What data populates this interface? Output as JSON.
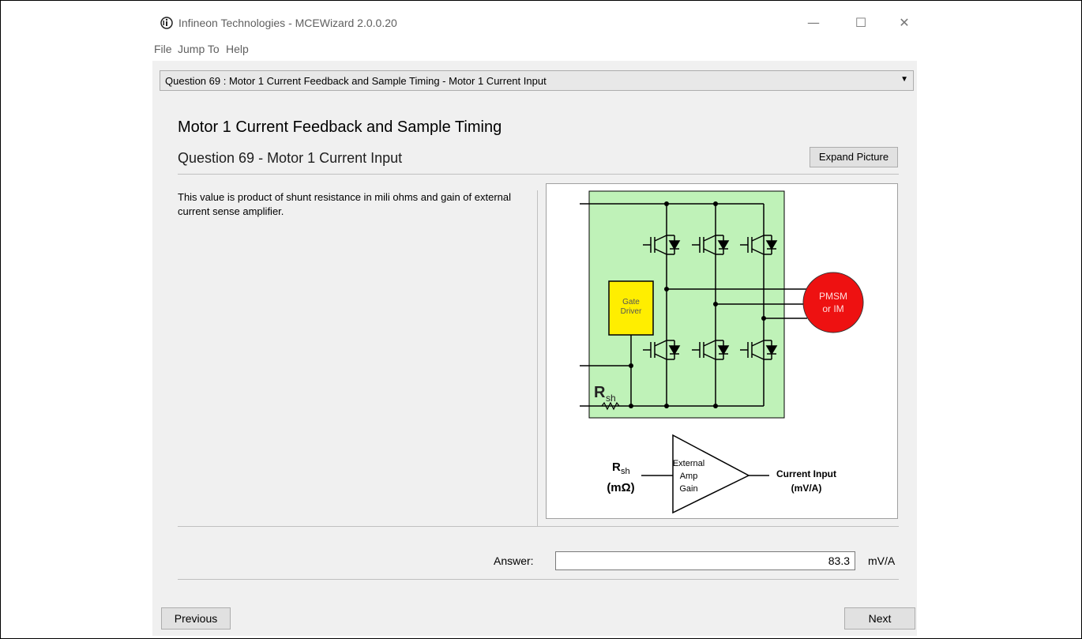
{
  "window": {
    "title": "Infineon Technologies - MCEWizard 2.0.0.20",
    "minimize_glyph": "—",
    "maximize_glyph": "☐",
    "close_glyph": "✕"
  },
  "menu": {
    "items": [
      "File",
      "Jump To",
      "Help"
    ]
  },
  "question_selector": {
    "value": "Question  69 : Motor 1 Current Feedback and Sample Timing - Motor 1 Current Input"
  },
  "content": {
    "section_title": "Motor 1 Current Feedback and Sample Timing",
    "question_title": "Question 69 - Motor 1 Current Input",
    "expand_button": "Expand Picture",
    "description": "This value is product of shunt resistance in mili ohms and gain of external current sense amplifier."
  },
  "picture": {
    "gate_driver_line1": "Gate",
    "gate_driver_line2": "Driver",
    "motor_line1": "PMSM",
    "motor_line2": "or IM",
    "rsh_main": "R",
    "rsh_sub": "sh",
    "rsh_unit": "(mΩ)",
    "amp_line1": "External",
    "amp_line2": "Amp",
    "amp_line3": "Gain",
    "output_line1": "Current Input",
    "output_line2": "(mV/A)",
    "colors": {
      "board": "#bff2b8",
      "gate_driver": "#ffee00",
      "motor": "#ee1111"
    }
  },
  "answer": {
    "label": "Answer:",
    "value": "83.3",
    "unit": "mV/A"
  },
  "navigation": {
    "previous": "Previous",
    "next": "Next"
  }
}
